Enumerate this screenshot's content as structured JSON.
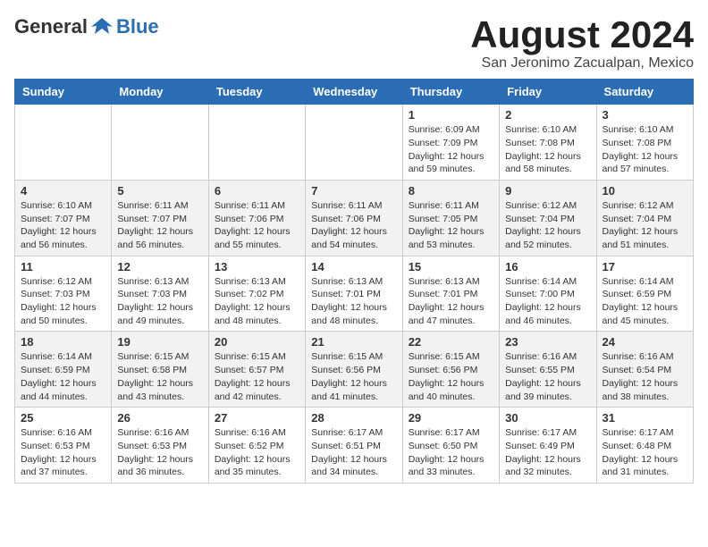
{
  "header": {
    "logo_general": "General",
    "logo_blue": "Blue",
    "month_title": "August 2024",
    "subtitle": "San Jeronimo Zacualpan, Mexico"
  },
  "weekdays": [
    "Sunday",
    "Monday",
    "Tuesday",
    "Wednesday",
    "Thursday",
    "Friday",
    "Saturday"
  ],
  "weeks": [
    [
      {
        "day": "",
        "info": ""
      },
      {
        "day": "",
        "info": ""
      },
      {
        "day": "",
        "info": ""
      },
      {
        "day": "",
        "info": ""
      },
      {
        "day": "1",
        "info": "Sunrise: 6:09 AM\nSunset: 7:09 PM\nDaylight: 12 hours\nand 59 minutes."
      },
      {
        "day": "2",
        "info": "Sunrise: 6:10 AM\nSunset: 7:08 PM\nDaylight: 12 hours\nand 58 minutes."
      },
      {
        "day": "3",
        "info": "Sunrise: 6:10 AM\nSunset: 7:08 PM\nDaylight: 12 hours\nand 57 minutes."
      }
    ],
    [
      {
        "day": "4",
        "info": "Sunrise: 6:10 AM\nSunset: 7:07 PM\nDaylight: 12 hours\nand 56 minutes."
      },
      {
        "day": "5",
        "info": "Sunrise: 6:11 AM\nSunset: 7:07 PM\nDaylight: 12 hours\nand 56 minutes."
      },
      {
        "day": "6",
        "info": "Sunrise: 6:11 AM\nSunset: 7:06 PM\nDaylight: 12 hours\nand 55 minutes."
      },
      {
        "day": "7",
        "info": "Sunrise: 6:11 AM\nSunset: 7:06 PM\nDaylight: 12 hours\nand 54 minutes."
      },
      {
        "day": "8",
        "info": "Sunrise: 6:11 AM\nSunset: 7:05 PM\nDaylight: 12 hours\nand 53 minutes."
      },
      {
        "day": "9",
        "info": "Sunrise: 6:12 AM\nSunset: 7:04 PM\nDaylight: 12 hours\nand 52 minutes."
      },
      {
        "day": "10",
        "info": "Sunrise: 6:12 AM\nSunset: 7:04 PM\nDaylight: 12 hours\nand 51 minutes."
      }
    ],
    [
      {
        "day": "11",
        "info": "Sunrise: 6:12 AM\nSunset: 7:03 PM\nDaylight: 12 hours\nand 50 minutes."
      },
      {
        "day": "12",
        "info": "Sunrise: 6:13 AM\nSunset: 7:03 PM\nDaylight: 12 hours\nand 49 minutes."
      },
      {
        "day": "13",
        "info": "Sunrise: 6:13 AM\nSunset: 7:02 PM\nDaylight: 12 hours\nand 48 minutes."
      },
      {
        "day": "14",
        "info": "Sunrise: 6:13 AM\nSunset: 7:01 PM\nDaylight: 12 hours\nand 48 minutes."
      },
      {
        "day": "15",
        "info": "Sunrise: 6:13 AM\nSunset: 7:01 PM\nDaylight: 12 hours\nand 47 minutes."
      },
      {
        "day": "16",
        "info": "Sunrise: 6:14 AM\nSunset: 7:00 PM\nDaylight: 12 hours\nand 46 minutes."
      },
      {
        "day": "17",
        "info": "Sunrise: 6:14 AM\nSunset: 6:59 PM\nDaylight: 12 hours\nand 45 minutes."
      }
    ],
    [
      {
        "day": "18",
        "info": "Sunrise: 6:14 AM\nSunset: 6:59 PM\nDaylight: 12 hours\nand 44 minutes."
      },
      {
        "day": "19",
        "info": "Sunrise: 6:15 AM\nSunset: 6:58 PM\nDaylight: 12 hours\nand 43 minutes."
      },
      {
        "day": "20",
        "info": "Sunrise: 6:15 AM\nSunset: 6:57 PM\nDaylight: 12 hours\nand 42 minutes."
      },
      {
        "day": "21",
        "info": "Sunrise: 6:15 AM\nSunset: 6:56 PM\nDaylight: 12 hours\nand 41 minutes."
      },
      {
        "day": "22",
        "info": "Sunrise: 6:15 AM\nSunset: 6:56 PM\nDaylight: 12 hours\nand 40 minutes."
      },
      {
        "day": "23",
        "info": "Sunrise: 6:16 AM\nSunset: 6:55 PM\nDaylight: 12 hours\nand 39 minutes."
      },
      {
        "day": "24",
        "info": "Sunrise: 6:16 AM\nSunset: 6:54 PM\nDaylight: 12 hours\nand 38 minutes."
      }
    ],
    [
      {
        "day": "25",
        "info": "Sunrise: 6:16 AM\nSunset: 6:53 PM\nDaylight: 12 hours\nand 37 minutes."
      },
      {
        "day": "26",
        "info": "Sunrise: 6:16 AM\nSunset: 6:53 PM\nDaylight: 12 hours\nand 36 minutes."
      },
      {
        "day": "27",
        "info": "Sunrise: 6:16 AM\nSunset: 6:52 PM\nDaylight: 12 hours\nand 35 minutes."
      },
      {
        "day": "28",
        "info": "Sunrise: 6:17 AM\nSunset: 6:51 PM\nDaylight: 12 hours\nand 34 minutes."
      },
      {
        "day": "29",
        "info": "Sunrise: 6:17 AM\nSunset: 6:50 PM\nDaylight: 12 hours\nand 33 minutes."
      },
      {
        "day": "30",
        "info": "Sunrise: 6:17 AM\nSunset: 6:49 PM\nDaylight: 12 hours\nand 32 minutes."
      },
      {
        "day": "31",
        "info": "Sunrise: 6:17 AM\nSunset: 6:48 PM\nDaylight: 12 hours\nand 31 minutes."
      }
    ]
  ]
}
